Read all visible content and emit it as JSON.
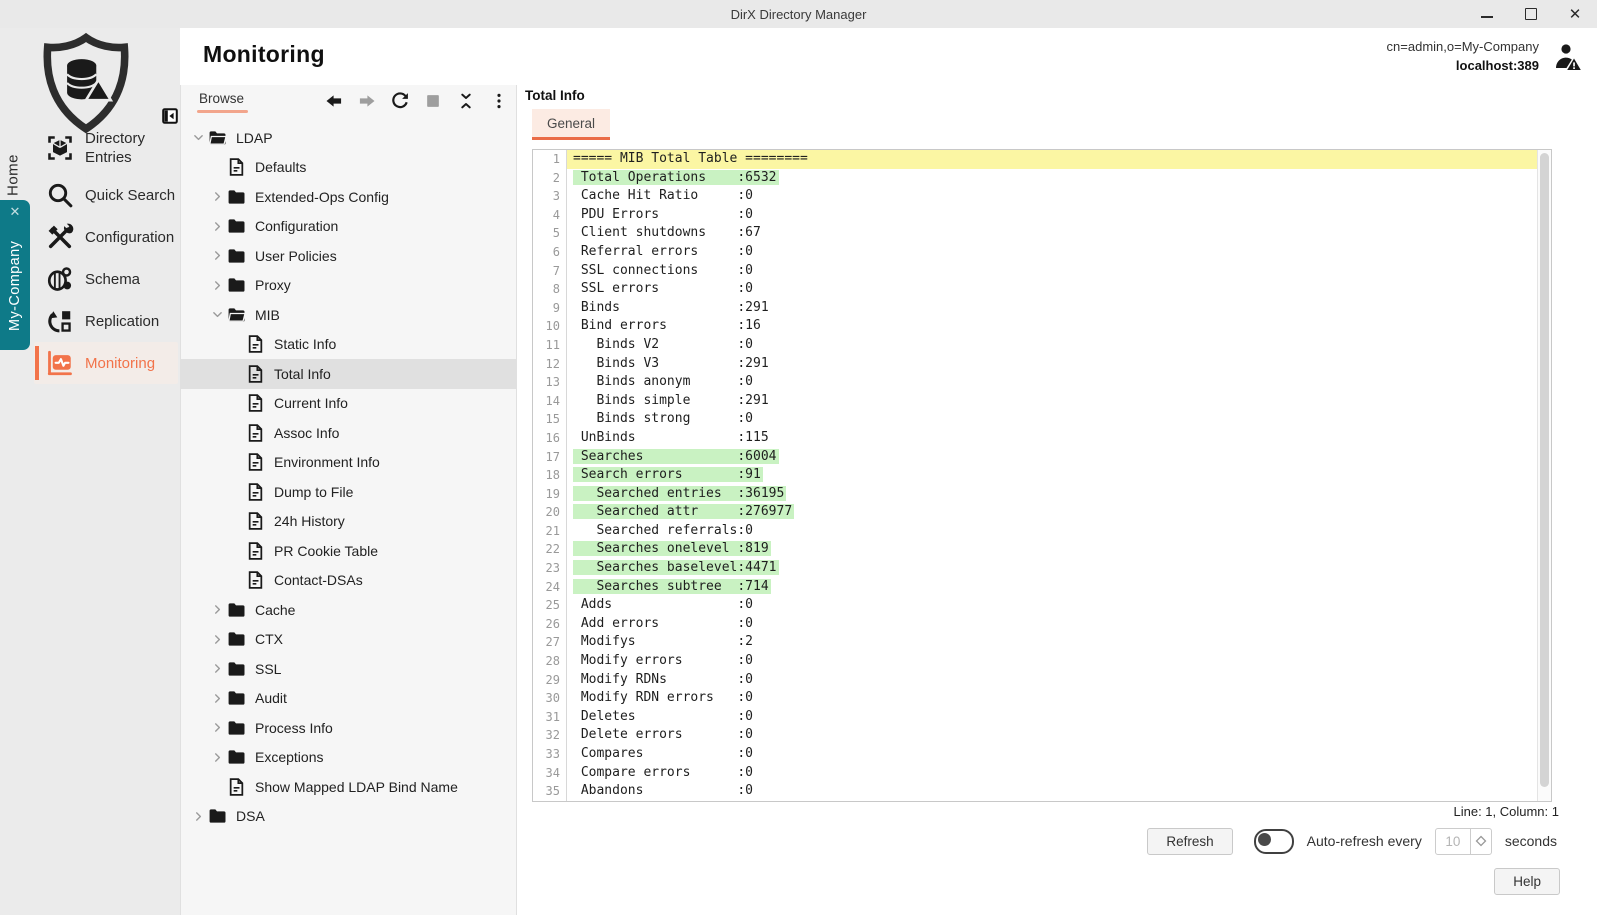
{
  "window": {
    "title": "DirX Directory Manager"
  },
  "header": {
    "title": "Monitoring",
    "connection_dn": "cn=admin,o=My-Company",
    "connection_host": "localhost:389",
    "user_icon": "user-warning-icon"
  },
  "sidebar": {
    "home_label": "Home",
    "company_tab": {
      "label": "My-Company",
      "close_icon": "close-icon"
    },
    "items": [
      {
        "label": "Directory Entries",
        "icon": "directory-entries-icon",
        "selected": false
      },
      {
        "label": "Quick Search",
        "icon": "quick-search-icon",
        "selected": false
      },
      {
        "label": "Configuration",
        "icon": "configuration-icon",
        "selected": false
      },
      {
        "label": "Schema",
        "icon": "schema-icon",
        "selected": false
      },
      {
        "label": "Replication",
        "icon": "replication-icon",
        "selected": false
      },
      {
        "label": "Monitoring",
        "icon": "monitoring-icon",
        "selected": true
      }
    ]
  },
  "browse_panel": {
    "tab_label": "Browse",
    "toolbar": [
      {
        "icon": "back-icon"
      },
      {
        "icon": "forward-icon"
      },
      {
        "icon": "refresh-icon"
      },
      {
        "icon": "stop-icon"
      },
      {
        "icon": "collapse-all-icon"
      },
      {
        "icon": "menu-icon"
      }
    ],
    "tree": [
      {
        "label": "LDAP",
        "type": "folder",
        "depth": 0,
        "expanded": true,
        "selected": false
      },
      {
        "label": "Defaults",
        "type": "file",
        "depth": 1,
        "selected": false
      },
      {
        "label": "Extended-Ops Config",
        "type": "folder",
        "depth": 1,
        "expanded": false,
        "selected": false
      },
      {
        "label": "Configuration",
        "type": "folder",
        "depth": 1,
        "expanded": false,
        "selected": false
      },
      {
        "label": "User Policies",
        "type": "folder",
        "depth": 1,
        "expanded": false,
        "selected": false
      },
      {
        "label": "Proxy",
        "type": "folder",
        "depth": 1,
        "expanded": false,
        "selected": false
      },
      {
        "label": "MIB",
        "type": "folder",
        "depth": 1,
        "expanded": true,
        "selected": false
      },
      {
        "label": "Static Info",
        "type": "file",
        "depth": 2,
        "selected": false
      },
      {
        "label": "Total Info",
        "type": "file",
        "depth": 2,
        "selected": true
      },
      {
        "label": "Current Info",
        "type": "file",
        "depth": 2,
        "selected": false
      },
      {
        "label": "Assoc Info",
        "type": "file",
        "depth": 2,
        "selected": false
      },
      {
        "label": "Environment Info",
        "type": "file",
        "depth": 2,
        "selected": false
      },
      {
        "label": "Dump to File",
        "type": "file",
        "depth": 2,
        "selected": false
      },
      {
        "label": "24h History",
        "type": "file",
        "depth": 2,
        "selected": false
      },
      {
        "label": "PR Cookie Table",
        "type": "file",
        "depth": 2,
        "selected": false
      },
      {
        "label": "Contact-DSAs",
        "type": "file",
        "depth": 2,
        "selected": false
      },
      {
        "label": "Cache",
        "type": "folder",
        "depth": 1,
        "expanded": false,
        "selected": false
      },
      {
        "label": "CTX",
        "type": "folder",
        "depth": 1,
        "expanded": false,
        "selected": false
      },
      {
        "label": "SSL",
        "type": "folder",
        "depth": 1,
        "expanded": false,
        "selected": false
      },
      {
        "label": "Audit",
        "type": "folder",
        "depth": 1,
        "expanded": false,
        "selected": false
      },
      {
        "label": "Process Info",
        "type": "folder",
        "depth": 1,
        "expanded": false,
        "selected": false
      },
      {
        "label": "Exceptions",
        "type": "folder",
        "depth": 1,
        "expanded": false,
        "selected": false
      },
      {
        "label": "Show Mapped LDAP Bind Name",
        "type": "file",
        "depth": 1,
        "selected": false
      },
      {
        "label": "DSA",
        "type": "folder",
        "depth": 0,
        "expanded": false,
        "selected": false
      }
    ]
  },
  "content": {
    "title": "Total Info",
    "tabs": [
      {
        "label": "General",
        "active": true
      }
    ],
    "editor": {
      "status": "Line: 1, Column: 1",
      "lines": [
        {
          "n": 1,
          "t": "===== MIB Total Table ========",
          "h": "y"
        },
        {
          "n": 2,
          "t": " Total Operations    :6532",
          "h": "g"
        },
        {
          "n": 3,
          "t": " Cache Hit Ratio     :0",
          "h": null
        },
        {
          "n": 4,
          "t": " PDU Errors          :0",
          "h": null
        },
        {
          "n": 5,
          "t": " Client shutdowns    :67",
          "h": null
        },
        {
          "n": 6,
          "t": " Referral errors     :0",
          "h": null
        },
        {
          "n": 7,
          "t": " SSL connections     :0",
          "h": null
        },
        {
          "n": 8,
          "t": " SSL errors          :0",
          "h": null
        },
        {
          "n": 9,
          "t": " Binds               :291",
          "h": null
        },
        {
          "n": 10,
          "t": " Bind errors         :16",
          "h": null
        },
        {
          "n": 11,
          "t": "   Binds V2          :0",
          "h": null
        },
        {
          "n": 12,
          "t": "   Binds V3          :291",
          "h": null
        },
        {
          "n": 13,
          "t": "   Binds anonym      :0",
          "h": null
        },
        {
          "n": 14,
          "t": "   Binds simple      :291",
          "h": null
        },
        {
          "n": 15,
          "t": "   Binds strong      :0",
          "h": null
        },
        {
          "n": 16,
          "t": " UnBinds             :115",
          "h": null
        },
        {
          "n": 17,
          "t": " Searches            :6004",
          "h": "g"
        },
        {
          "n": 18,
          "t": " Search errors       :91",
          "h": "g"
        },
        {
          "n": 19,
          "t": "   Searched entries  :36195",
          "h": "g"
        },
        {
          "n": 20,
          "t": "   Searched attr     :276977",
          "h": "g"
        },
        {
          "n": 21,
          "t": "   Searched referrals:0",
          "h": null
        },
        {
          "n": 22,
          "t": "   Searches onelevel :819",
          "h": "g"
        },
        {
          "n": 23,
          "t": "   Searches baselevel:4471",
          "h": "g"
        },
        {
          "n": 24,
          "t": "   Searches subtree  :714",
          "h": "g"
        },
        {
          "n": 25,
          "t": " Adds                :0",
          "h": null
        },
        {
          "n": 26,
          "t": " Add errors          :0",
          "h": null
        },
        {
          "n": 27,
          "t": " Modifys             :2",
          "h": null
        },
        {
          "n": 28,
          "t": " Modify errors       :0",
          "h": null
        },
        {
          "n": 29,
          "t": " Modify RDNs         :0",
          "h": null
        },
        {
          "n": 30,
          "t": " Modify RDN errors   :0",
          "h": null
        },
        {
          "n": 31,
          "t": " Deletes             :0",
          "h": null
        },
        {
          "n": 32,
          "t": " Delete errors       :0",
          "h": null
        },
        {
          "n": 33,
          "t": " Compares            :0",
          "h": null
        },
        {
          "n": 34,
          "t": " Compare errors      :0",
          "h": null
        },
        {
          "n": 35,
          "t": " Abandons            :0",
          "h": null
        }
      ]
    },
    "controls": {
      "refresh_label": "Refresh",
      "toggle_on": false,
      "auto_refresh_label": "Auto-refresh every",
      "interval_value": "10",
      "seconds_label": "seconds",
      "help_label": "Help"
    }
  },
  "colors": {
    "accent_orange": "#f2734a",
    "teal_tab": "#0e7a88",
    "highlight_yellow": "#fbf6a3",
    "highlight_green": "#c9f2c2",
    "titlebar_bg": "#e9e9e9",
    "sidebar_bg": "#ebebeb",
    "tree_bg": "#f6f6f6",
    "tree_selected_bg": "#e0e0e0"
  }
}
